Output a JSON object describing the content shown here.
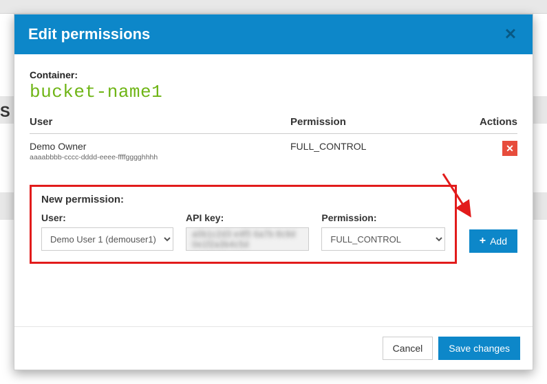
{
  "dialog": {
    "title": "Edit permissions",
    "container_label": "Container:",
    "container_name": "bucket-name1"
  },
  "table": {
    "headers": {
      "user": "User",
      "permission": "Permission",
      "actions": "Actions"
    },
    "rows": [
      {
        "user_name": "Demo Owner",
        "user_id": "aaaabbbb-cccc-dddd-eeee-ffffgggghhhh",
        "permission": "FULL_CONTROL"
      }
    ]
  },
  "new_permission": {
    "title": "New permission:",
    "user_label": "User:",
    "api_key_label": "API key:",
    "permission_label": "Permission:",
    "user_selected": "Demo User 1 (demouser1)",
    "api_key_masked": "a0b1c2d3 e4f5 6a7b 8c9d 0e1f2a3b4c5d",
    "permission_selected": "FULL_CONTROL",
    "add_label": "Add"
  },
  "footer": {
    "cancel": "Cancel",
    "save": "Save changes"
  },
  "background_hint": "S"
}
